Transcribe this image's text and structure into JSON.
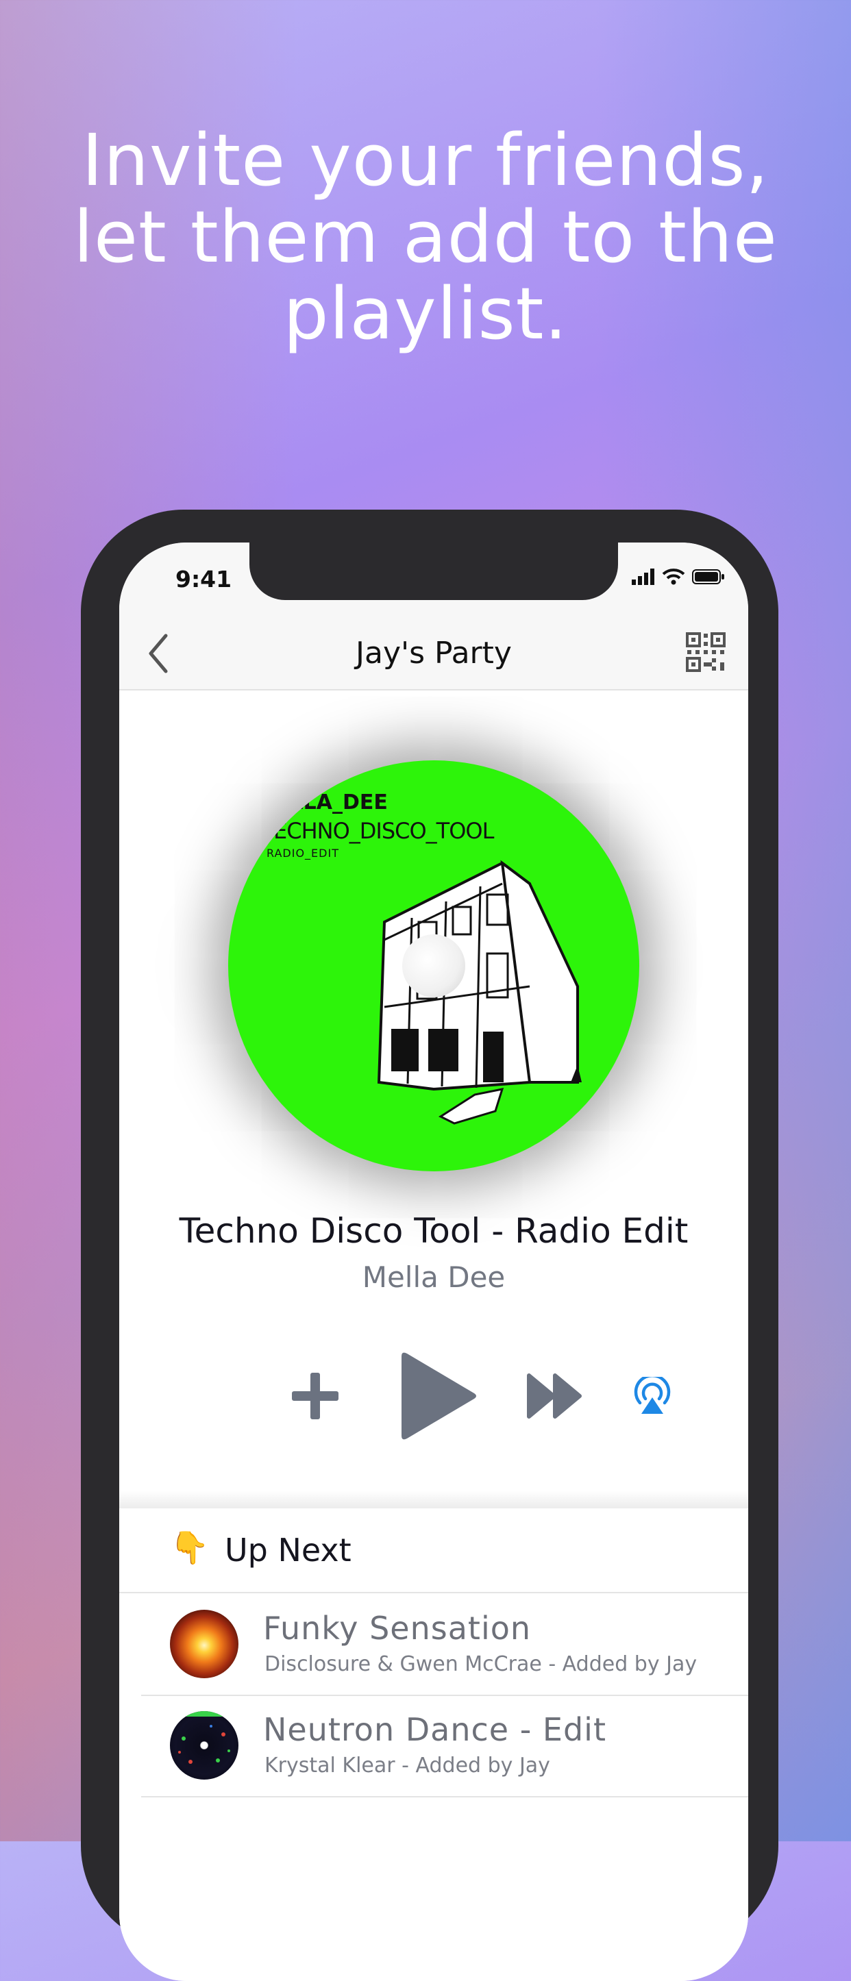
{
  "headline": {
    "line1": "Invite your friends,",
    "line2": "let them add to the",
    "line3": "playlist."
  },
  "status_bar": {
    "time": "9:41"
  },
  "nav": {
    "title": "Jay's Party"
  },
  "now_playing": {
    "cover": {
      "artist_text": "ELLA_DEE",
      "title_text": "ECHNO_DISCO_TOOL",
      "edit_text": "RADIO_EDIT"
    },
    "title": "Techno Disco Tool - Radio Edit",
    "artist": "Mella Dee"
  },
  "controls": {
    "add_icon": "plus-icon",
    "play_icon": "play-icon",
    "skip_icon": "fast-forward-icon",
    "airplay_icon": "airplay-icon",
    "accent": "#1e88e5",
    "control_color": "#6b7280"
  },
  "queue": {
    "header_emoji": "👇",
    "header_label": "Up Next",
    "items": [
      {
        "title": "Funky Sensation",
        "subtitle": "Disclosure & Gwen McCrae - Added by Jay"
      },
      {
        "title": "Neutron Dance - Edit",
        "subtitle": "Krystal Klear - Added by Jay"
      }
    ]
  }
}
